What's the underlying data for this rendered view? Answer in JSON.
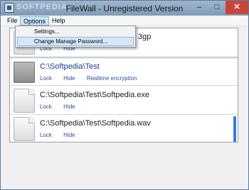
{
  "window": {
    "title": "FileWall - Unregistered Version",
    "watermark": "SOFTPEDIA",
    "controls": {
      "minimize": "–",
      "maximize": "□",
      "close": "✕"
    }
  },
  "menu": {
    "items": [
      "File",
      "Options",
      "Help"
    ],
    "options_dropdown": [
      "Settings...",
      "Change Manage Password..."
    ]
  },
  "files": [
    {
      "path": "C:\\Softpedia\\Test\\Softpedia.3gp",
      "visible_path_tail": "3gp",
      "icon": "document-icon",
      "actions": [
        "Lock",
        "Hide"
      ]
    },
    {
      "path": "C:\\Softpedia\\Test",
      "icon": "folder-icon",
      "actions": [
        "Lock",
        "Hide",
        "Realtime encryption"
      ]
    },
    {
      "path": "C:\\Softpedia\\Test\\Softpedia.exe",
      "icon": "document-icon",
      "actions": [
        "Lock",
        "Hide"
      ]
    },
    {
      "path": "C:\\Softpedia\\Test\\Softpedia.wav",
      "icon": "document-icon",
      "actions": [
        "Lock",
        "Hide"
      ]
    }
  ],
  "colors": {
    "titlebar": "#8fa8c2",
    "menu_highlight": "#cde4f7",
    "link": "#2a4ea0",
    "close_button": "#c7463a"
  }
}
